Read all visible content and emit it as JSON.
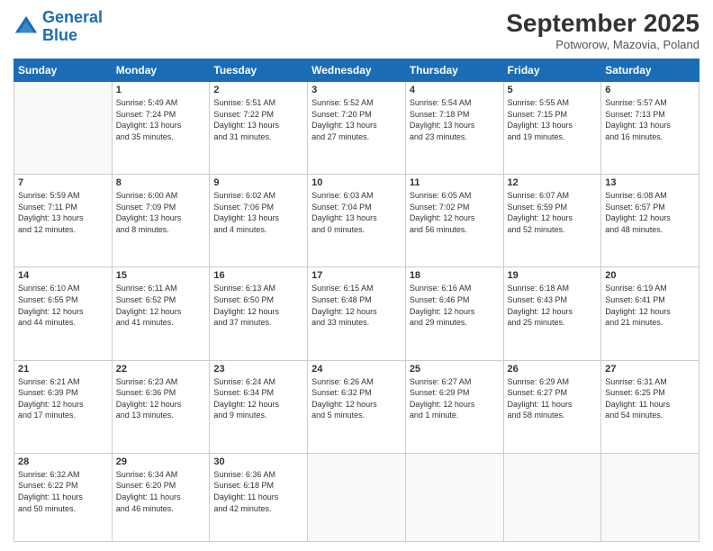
{
  "header": {
    "logo_line1": "General",
    "logo_line2": "Blue",
    "month": "September 2025",
    "location": "Potworow, Mazovia, Poland"
  },
  "weekdays": [
    "Sunday",
    "Monday",
    "Tuesday",
    "Wednesday",
    "Thursday",
    "Friday",
    "Saturday"
  ],
  "weeks": [
    [
      {
        "day": "",
        "info": ""
      },
      {
        "day": "1",
        "info": "Sunrise: 5:49 AM\nSunset: 7:24 PM\nDaylight: 13 hours\nand 35 minutes."
      },
      {
        "day": "2",
        "info": "Sunrise: 5:51 AM\nSunset: 7:22 PM\nDaylight: 13 hours\nand 31 minutes."
      },
      {
        "day": "3",
        "info": "Sunrise: 5:52 AM\nSunset: 7:20 PM\nDaylight: 13 hours\nand 27 minutes."
      },
      {
        "day": "4",
        "info": "Sunrise: 5:54 AM\nSunset: 7:18 PM\nDaylight: 13 hours\nand 23 minutes."
      },
      {
        "day": "5",
        "info": "Sunrise: 5:55 AM\nSunset: 7:15 PM\nDaylight: 13 hours\nand 19 minutes."
      },
      {
        "day": "6",
        "info": "Sunrise: 5:57 AM\nSunset: 7:13 PM\nDaylight: 13 hours\nand 16 minutes."
      }
    ],
    [
      {
        "day": "7",
        "info": "Sunrise: 5:59 AM\nSunset: 7:11 PM\nDaylight: 13 hours\nand 12 minutes."
      },
      {
        "day": "8",
        "info": "Sunrise: 6:00 AM\nSunset: 7:09 PM\nDaylight: 13 hours\nand 8 minutes."
      },
      {
        "day": "9",
        "info": "Sunrise: 6:02 AM\nSunset: 7:06 PM\nDaylight: 13 hours\nand 4 minutes."
      },
      {
        "day": "10",
        "info": "Sunrise: 6:03 AM\nSunset: 7:04 PM\nDaylight: 13 hours\nand 0 minutes."
      },
      {
        "day": "11",
        "info": "Sunrise: 6:05 AM\nSunset: 7:02 PM\nDaylight: 12 hours\nand 56 minutes."
      },
      {
        "day": "12",
        "info": "Sunrise: 6:07 AM\nSunset: 6:59 PM\nDaylight: 12 hours\nand 52 minutes."
      },
      {
        "day": "13",
        "info": "Sunrise: 6:08 AM\nSunset: 6:57 PM\nDaylight: 12 hours\nand 48 minutes."
      }
    ],
    [
      {
        "day": "14",
        "info": "Sunrise: 6:10 AM\nSunset: 6:55 PM\nDaylight: 12 hours\nand 44 minutes."
      },
      {
        "day": "15",
        "info": "Sunrise: 6:11 AM\nSunset: 6:52 PM\nDaylight: 12 hours\nand 41 minutes."
      },
      {
        "day": "16",
        "info": "Sunrise: 6:13 AM\nSunset: 6:50 PM\nDaylight: 12 hours\nand 37 minutes."
      },
      {
        "day": "17",
        "info": "Sunrise: 6:15 AM\nSunset: 6:48 PM\nDaylight: 12 hours\nand 33 minutes."
      },
      {
        "day": "18",
        "info": "Sunrise: 6:16 AM\nSunset: 6:46 PM\nDaylight: 12 hours\nand 29 minutes."
      },
      {
        "day": "19",
        "info": "Sunrise: 6:18 AM\nSunset: 6:43 PM\nDaylight: 12 hours\nand 25 minutes."
      },
      {
        "day": "20",
        "info": "Sunrise: 6:19 AM\nSunset: 6:41 PM\nDaylight: 12 hours\nand 21 minutes."
      }
    ],
    [
      {
        "day": "21",
        "info": "Sunrise: 6:21 AM\nSunset: 6:39 PM\nDaylight: 12 hours\nand 17 minutes."
      },
      {
        "day": "22",
        "info": "Sunrise: 6:23 AM\nSunset: 6:36 PM\nDaylight: 12 hours\nand 13 minutes."
      },
      {
        "day": "23",
        "info": "Sunrise: 6:24 AM\nSunset: 6:34 PM\nDaylight: 12 hours\nand 9 minutes."
      },
      {
        "day": "24",
        "info": "Sunrise: 6:26 AM\nSunset: 6:32 PM\nDaylight: 12 hours\nand 5 minutes."
      },
      {
        "day": "25",
        "info": "Sunrise: 6:27 AM\nSunset: 6:29 PM\nDaylight: 12 hours\nand 1 minute."
      },
      {
        "day": "26",
        "info": "Sunrise: 6:29 AM\nSunset: 6:27 PM\nDaylight: 11 hours\nand 58 minutes."
      },
      {
        "day": "27",
        "info": "Sunrise: 6:31 AM\nSunset: 6:25 PM\nDaylight: 11 hours\nand 54 minutes."
      }
    ],
    [
      {
        "day": "28",
        "info": "Sunrise: 6:32 AM\nSunset: 6:22 PM\nDaylight: 11 hours\nand 50 minutes."
      },
      {
        "day": "29",
        "info": "Sunrise: 6:34 AM\nSunset: 6:20 PM\nDaylight: 11 hours\nand 46 minutes."
      },
      {
        "day": "30",
        "info": "Sunrise: 6:36 AM\nSunset: 6:18 PM\nDaylight: 11 hours\nand 42 minutes."
      },
      {
        "day": "",
        "info": ""
      },
      {
        "day": "",
        "info": ""
      },
      {
        "day": "",
        "info": ""
      },
      {
        "day": "",
        "info": ""
      }
    ]
  ]
}
